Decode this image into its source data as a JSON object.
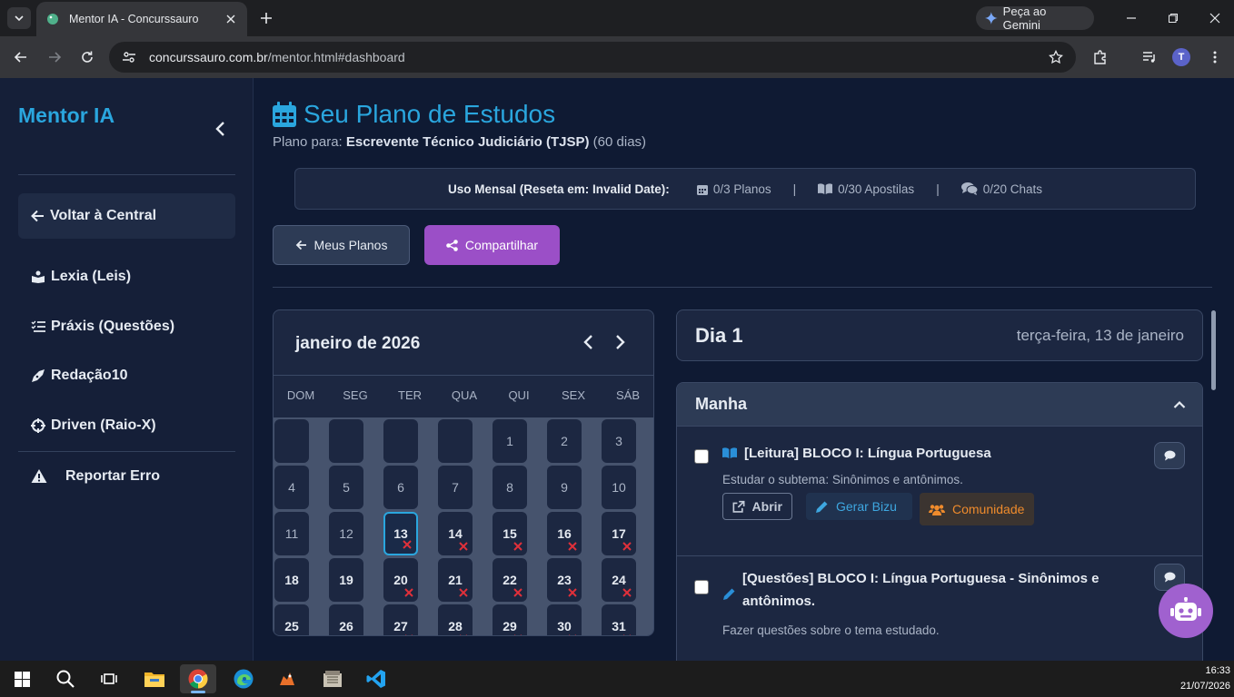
{
  "browser": {
    "tab_title": "Mentor IA - Concurssauro",
    "url_host": "concurssauro.com.br",
    "url_path": "/mentor.html#dashboard",
    "gemini_label": "Peça ao Gemini",
    "profile_initial": "T"
  },
  "sidebar": {
    "brand": "Mentor IA",
    "back_label": "Voltar à Central",
    "items": [
      {
        "label": "Lexia (Leis)",
        "icon": "book-reader-icon"
      },
      {
        "label": "Práxis (Questões)",
        "icon": "list-check-icon"
      },
      {
        "label": "Redação10",
        "icon": "pen-nib-icon"
      },
      {
        "label": "Driven (Raio-X)",
        "icon": "crosshair-icon"
      }
    ],
    "report_label": "Reportar Erro"
  },
  "header": {
    "title": "Seu Plano de Estudos",
    "plan_prefix": "Plano para: ",
    "plan_name": "Escrevente Técnico Judiciário (TJSP)",
    "plan_days": " (60 dias)"
  },
  "usage": {
    "label": "Uso Mensal (Reseta em: Invalid Date):",
    "plans": "0/3 Planos",
    "apostilas": "0/30 Apostilas",
    "chats": "0/20 Chats",
    "separator": "|"
  },
  "actions": {
    "my_plans": "Meus Planos",
    "share": "Compartilhar"
  },
  "calendar": {
    "month": "janeiro de 2026",
    "weekdays": [
      "DOM",
      "SEG",
      "TER",
      "QUA",
      "QUI",
      "SEX",
      "SÁB"
    ],
    "selected_day": 13,
    "missed_days": [
      13,
      14,
      15,
      16,
      17,
      20,
      21,
      22,
      23,
      24,
      27,
      28,
      29,
      30,
      31
    ]
  },
  "day": {
    "title": "Dia 1",
    "date": "terça-feira, 13 de janeiro"
  },
  "period": {
    "title": "Manha",
    "tasks": [
      {
        "title": "[Leitura] BLOCO I: Língua Portuguesa",
        "desc": "Estudar o subtema: Sinônimos e antônimos.",
        "open": "Abrir",
        "bizu": "Gerar Bizu",
        "community": "Comunidade"
      },
      {
        "title": "[Questões] BLOCO I: Língua Portuguesa - Sinônimos e antônimos.",
        "desc": "Fazer questões sobre o tema estudado."
      }
    ]
  },
  "taskbar": {
    "time": "16:33",
    "date": "21/07/2026"
  },
  "colors": {
    "accent": "#2aa6de",
    "share": "#9b4fc7",
    "missed": "#e0303a",
    "community": "#ef8b2c"
  }
}
